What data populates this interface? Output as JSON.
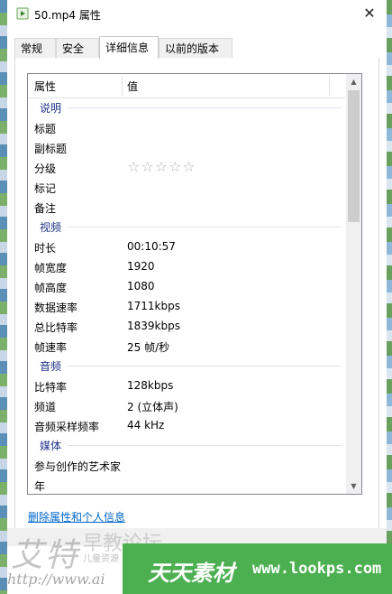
{
  "window": {
    "title": "50.mp4 属性",
    "close_glyph": "✕"
  },
  "tabs": [
    {
      "label": "常规"
    },
    {
      "label": "安全"
    },
    {
      "label": "详细信息",
      "active": true
    },
    {
      "label": "以前的版本"
    }
  ],
  "details": {
    "col_property": "属性",
    "col_value": "值",
    "groups": {
      "description": {
        "label": "说明",
        "rows": [
          {
            "p": "标题",
            "v": ""
          },
          {
            "p": "副标题",
            "v": ""
          },
          {
            "p": "分级",
            "v": "",
            "rating_stars": 0,
            "rating_max": 5
          },
          {
            "p": "标记",
            "v": ""
          },
          {
            "p": "备注",
            "v": ""
          }
        ]
      },
      "video": {
        "label": "视频",
        "rows": [
          {
            "p": "时长",
            "v": "00:10:57"
          },
          {
            "p": "帧宽度",
            "v": "1920"
          },
          {
            "p": "帧高度",
            "v": "1080"
          },
          {
            "p": "数据速率",
            "v": "1711kbps"
          },
          {
            "p": "总比特率",
            "v": "1839kbps"
          },
          {
            "p": "帧速率",
            "v": "25 帧/秒"
          }
        ]
      },
      "audio": {
        "label": "音频",
        "rows": [
          {
            "p": "比特率",
            "v": "128kbps"
          },
          {
            "p": "频道",
            "v": "2 (立体声)"
          },
          {
            "p": "音频采样频率",
            "v": "44 kHz"
          }
        ]
      },
      "media": {
        "label": "媒体",
        "rows": [
          {
            "p": "参与创作的艺术家",
            "v": ""
          },
          {
            "p": "年",
            "v": ""
          }
        ]
      }
    }
  },
  "links": {
    "remove_properties": "删除属性和个人信息"
  },
  "watermark": {
    "left_big": "艾特",
    "left_url": "http://www.ai",
    "mid_text": "早教论坛",
    "mid_sub": "儿童资源",
    "banner_cn": "天天素材",
    "banner_url": "www.lookps.com"
  },
  "colors": {
    "group_label": "#1e3287",
    "link": "#0066cc",
    "banner": "#4caf50",
    "star": "#b5b5b5"
  }
}
